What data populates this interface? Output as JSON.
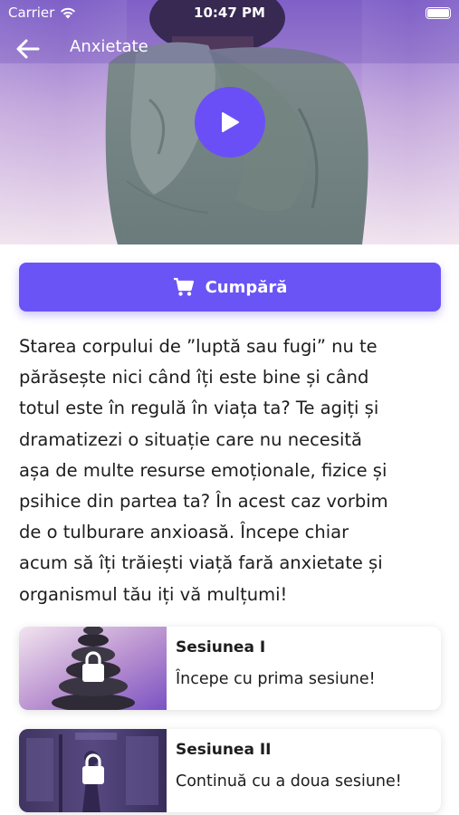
{
  "status_bar": {
    "carrier": "Carrier",
    "time": "10:47 PM"
  },
  "nav": {
    "back_icon": "arrow-left-icon",
    "title": "Anxietate"
  },
  "video": {
    "play_icon": "play-icon"
  },
  "buy_button": {
    "icon": "cart-icon",
    "label": "Cumpără"
  },
  "description": [
    "Starea corpului de ”luptă sau fugi” nu te",
    "părăsește nici când îți este bine și când",
    "totul este în regulă în viața ta? Te agiți și",
    "dramatizezi o situație care nu necesită",
    "așa de multe resurse emoționale, fizice și",
    "psihice din partea ta? În acest caz vorbim",
    "de o tulburare anxioasă. Începe chiar",
    "acum să îți trăiești viață fară anxietate și",
    "organismul tău iți vă mulțumi!"
  ],
  "sessions": [
    {
      "title": "Sesiunea I",
      "subtitle": "Începe cu prima sesiune!",
      "locked": true
    },
    {
      "title": "Sesiunea II",
      "subtitle": "Continuă cu a doua sesiune!",
      "locked": true
    }
  ],
  "colors": {
    "accent": "#6a54f6",
    "play": "#6b4ff6"
  }
}
